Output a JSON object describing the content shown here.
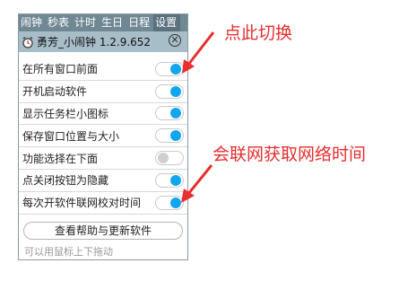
{
  "menu": {
    "items": [
      {
        "label": "闹钟"
      },
      {
        "label": "秒表"
      },
      {
        "label": "计时"
      },
      {
        "label": "生日"
      },
      {
        "label": "日程"
      },
      {
        "label": "设置"
      }
    ],
    "active_index": 5
  },
  "window": {
    "title": "勇芳_小闹钟 1.2.9.652",
    "icon": "alarm-clock-icon",
    "close_symbol": "✕"
  },
  "settings": [
    {
      "label": "在所有窗口前面",
      "state": "on"
    },
    {
      "label": "开机启动软件",
      "state": "on"
    },
    {
      "label": "显示任务栏小图标",
      "state": "on"
    },
    {
      "label": "保存窗口位置与大小",
      "state": "on"
    },
    {
      "label": "功能选择在下面",
      "state": "off"
    },
    {
      "label": "点关闭按钮为隐藏",
      "state": "on"
    },
    {
      "label": "每次开软件联网校对时间",
      "state": "on"
    }
  ],
  "help_button": {
    "label": "查看帮助与更新软件"
  },
  "hint": "可以用鼠标上下拖动",
  "annotations": {
    "toggle_note": "点此切换",
    "network_note": "会联网获取网络时间"
  },
  "colors": {
    "menubar": "#6f8894",
    "titlebar": "#a7bec8",
    "toggle_on": "#12a6ef",
    "toggle_off": "#cfcfcf",
    "annotation": "#e82e2e"
  }
}
